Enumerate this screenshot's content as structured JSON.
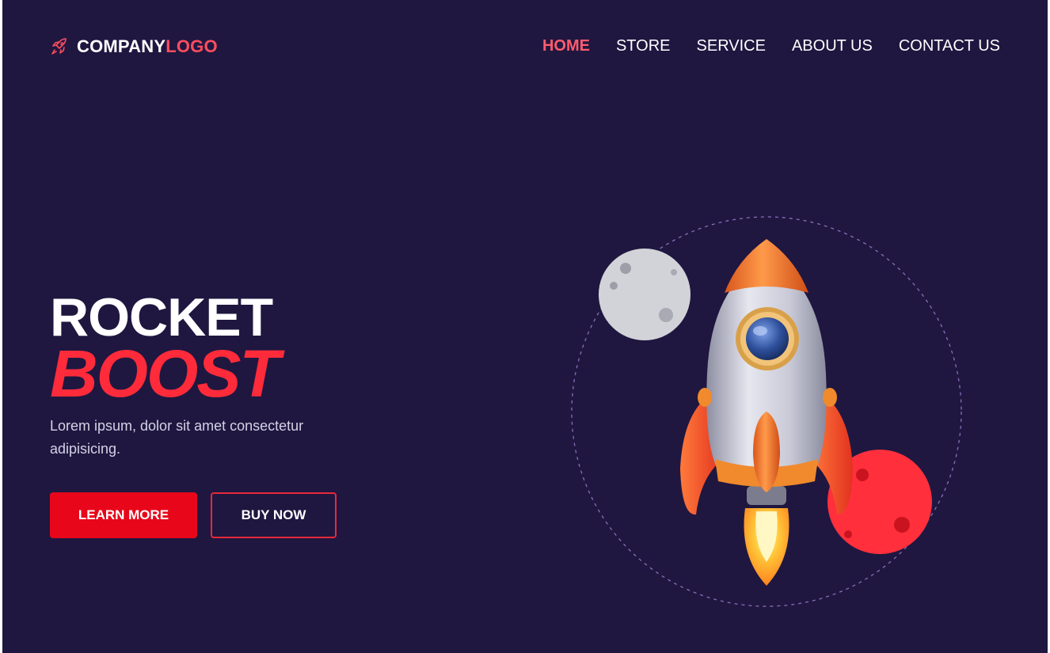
{
  "header": {
    "logo_main": "COMPANY",
    "logo_accent": "LOGO",
    "logo_icon": "rocket-icon"
  },
  "nav": {
    "items": [
      {
        "label": "HOME",
        "active": true
      },
      {
        "label": "STORE",
        "active": false
      },
      {
        "label": "SERVICE",
        "active": false
      },
      {
        "label": "ABOUT US",
        "active": false
      },
      {
        "label": "CONTACT US",
        "active": false
      }
    ]
  },
  "hero": {
    "title_line1": "ROCKET",
    "title_line2": "BOOST",
    "description": "Lorem ipsum, dolor sit amet consectetur adipisicing.",
    "primary_button": "LEARN MORE",
    "secondary_button": "BUY NOW"
  },
  "colors": {
    "background": "#1f1740",
    "accent": "#ff2b3a",
    "nav_active": "#ff5c6c",
    "button_primary": "#e8071a"
  }
}
